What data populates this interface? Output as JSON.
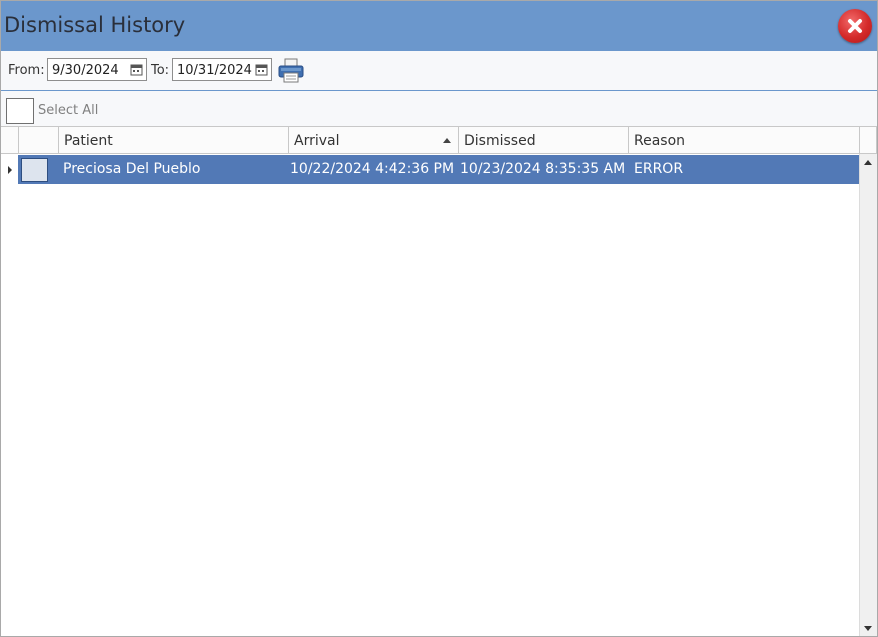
{
  "window": {
    "title": "Dismissal History"
  },
  "filter": {
    "from_label": "From:",
    "from_value": "9/30/2024",
    "to_label": "To:",
    "to_value": "10/31/2024"
  },
  "select_all": {
    "label": "Select All"
  },
  "grid": {
    "columns": [
      "Patient",
      "Arrival",
      "Dismissed",
      "Reason"
    ],
    "sorted_column": "Arrival",
    "sort_direction": "ascending",
    "rows": [
      {
        "patient": "Preciosa Del Pueblo",
        "arrival": "10/22/2024 4:42:36 PM",
        "dismissed": "10/23/2024 8:35:35 AM",
        "reason": "ERROR",
        "selected": true
      }
    ]
  },
  "colors": {
    "title_bar": "#6b97cc",
    "selected_row": "#5279b6",
    "close_button": "#d42a2a"
  },
  "icons": {
    "close": "close-icon",
    "calendar": "calendar-icon",
    "print": "printer-icon"
  }
}
